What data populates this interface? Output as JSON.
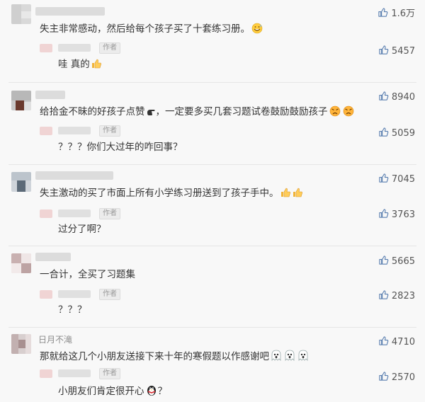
{
  "comments": [
    {
      "name": "",
      "text": "失主非常感动，然后给每个孩子买了十套练习册。",
      "likes": "1.6万",
      "reply": {
        "author_tag": "作者",
        "text": "哇 真的",
        "likes": "5457"
      }
    },
    {
      "name": "",
      "text": "给拾金不昧的好孩子点赞",
      "text2": "，一定要多买几套习题试卷鼓励鼓励孩子",
      "likes": "8940",
      "reply": {
        "author_tag": "作者",
        "text": "？？？你们大过年的咋回事？",
        "likes": "5059"
      }
    },
    {
      "name": "",
      "text": "失主激动的买了市面上所有小学练习册送到了孩子手中。",
      "likes": "7045",
      "reply": {
        "author_tag": "作者",
        "text": "过分了啊？",
        "likes": "3763"
      }
    },
    {
      "name": "",
      "text": "一合计，全买了习题集",
      "likes": "5665",
      "reply": {
        "author_tag": "作者",
        "text": "？？？",
        "likes": "2823"
      }
    },
    {
      "name": "日月不滝",
      "text": "那就给这几个小朋友送接下来十年的寒假题以作感谢吧",
      "likes": "4710",
      "reply": {
        "author_tag": "作者",
        "text": "小朋友们肯定很开心",
        "text2": "？",
        "likes": "2570"
      }
    }
  ],
  "colors": {
    "text": "#333333",
    "muted": "#8a8a8a",
    "background": "#f8f8f8",
    "thumb": "#5a7fb0"
  },
  "icons": {
    "like": "thumbs-up-icon",
    "blurred_avatar": "avatar"
  }
}
